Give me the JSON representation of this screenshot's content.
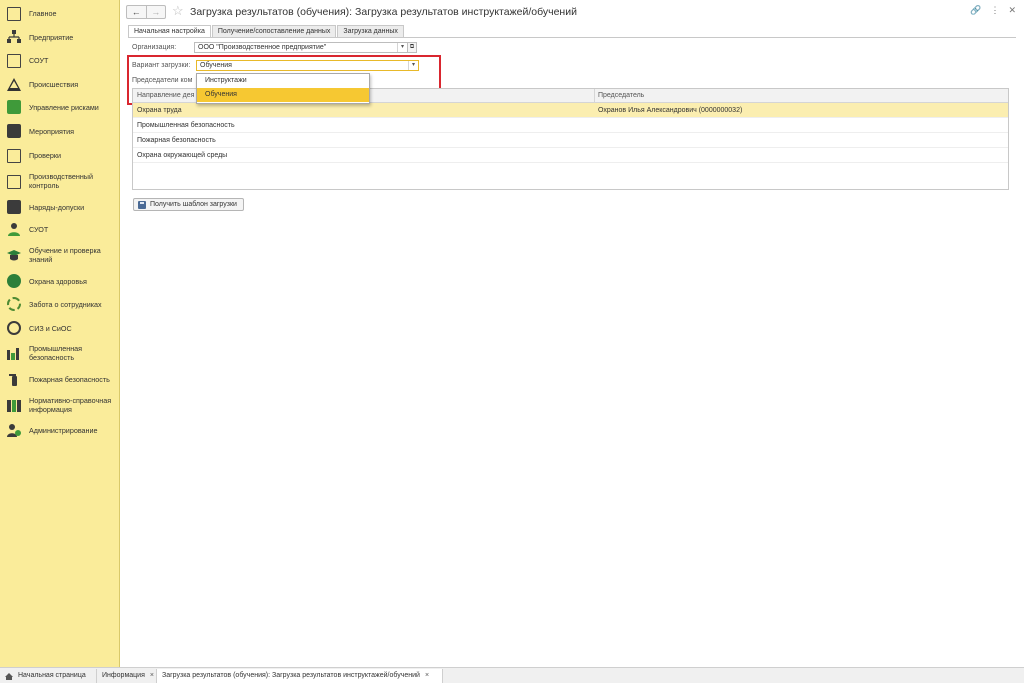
{
  "sidebar": {
    "items": [
      {
        "label": "Главное",
        "icon": "monitor-icon"
      },
      {
        "label": "Предприятие",
        "icon": "org-structure-icon"
      },
      {
        "label": "СОУТ",
        "icon": "clipboard-icon"
      },
      {
        "label": "Происшествия",
        "icon": "warning-icon"
      },
      {
        "label": "Управление рисками",
        "icon": "risk-icon"
      },
      {
        "label": "Мероприятия",
        "icon": "checklist-icon"
      },
      {
        "label": "Проверки",
        "icon": "inspection-icon"
      },
      {
        "label": "Производственный контроль",
        "icon": "production-control-icon"
      },
      {
        "label": "Наряды-допуски",
        "icon": "permit-icon"
      },
      {
        "label": "СУОТ",
        "icon": "worker-icon"
      },
      {
        "label": "Обучение и проверка знаний",
        "icon": "training-icon"
      },
      {
        "label": "Охрана здоровья",
        "icon": "health-icon"
      },
      {
        "label": "Забота о сотрудниках",
        "icon": "care-icon"
      },
      {
        "label": "СИЗ и СиОС",
        "icon": "ppe-icon"
      },
      {
        "label": "Промышленная безопасность",
        "icon": "industrial-safety-icon"
      },
      {
        "label": "Пожарная безопасность",
        "icon": "fire-extinguisher-icon"
      },
      {
        "label": "Нормативно-справочная информация",
        "icon": "reference-books-icon"
      },
      {
        "label": "Администрирование",
        "icon": "admin-icon"
      }
    ]
  },
  "window": {
    "title": "Загрузка результатов (обучения): Загрузка результатов инструктажей/обучений",
    "back": "←",
    "forward": "→",
    "star": "☆",
    "link": "🔗",
    "menu": "⋮",
    "close": "✕"
  },
  "tabs": [
    {
      "label": "Начальная настройка",
      "active": true
    },
    {
      "label": "Получение/сопоставление данных",
      "active": false
    },
    {
      "label": "Загрузка данных",
      "active": false
    }
  ],
  "form": {
    "organization_label": "Организация:",
    "organization_value": "ООО \"Производственное предприятие\"",
    "variant_label": "Вариант загрузки:",
    "variant_value": "Обучения",
    "chairs_label": "Председатели ком",
    "dropdown_arrow": "▾",
    "open_symbol": "⧉"
  },
  "dropdown": {
    "options": [
      {
        "label": "Инструктажи",
        "selected": false
      },
      {
        "label": "Обучения",
        "selected": true
      }
    ]
  },
  "grid": {
    "columns": [
      "Направление дея",
      "Председатель"
    ],
    "rows": [
      {
        "direction": "Охрана труда",
        "chair": "Охранов Илья Александрович (0000000032)",
        "selected": true
      },
      {
        "direction": "Промышленная безопасность",
        "chair": "",
        "selected": false
      },
      {
        "direction": "Пожарная безопасность",
        "chair": "",
        "selected": false
      },
      {
        "direction": "Охрана окружающей среды",
        "chair": "",
        "selected": false
      }
    ]
  },
  "template_button": {
    "label": "Получить шаблон загрузки"
  },
  "bottom_tabs": [
    {
      "label": "Начальная страница",
      "closable": false
    },
    {
      "label": "Информация",
      "closable": true
    },
    {
      "label": "Загрузка результатов (обучения): Загрузка результатов инструктажей/обучений",
      "closable": true
    }
  ],
  "close_symbol": "×",
  "colors": {
    "sidebar_bg": "#faec9a",
    "highlight_border": "#d9262f",
    "selected_option": "#f6c832",
    "selected_row": "#fbeeb0"
  }
}
